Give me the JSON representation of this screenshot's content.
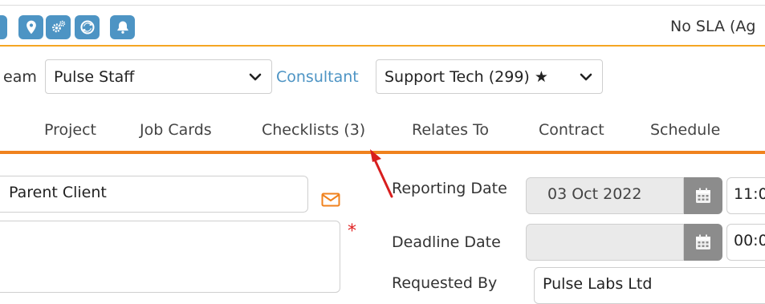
{
  "header": {
    "sla_text": "No SLA (Ag",
    "icons": [
      "map-pin-icon",
      "cogs-icon",
      "refresh-icon",
      "bell-icon"
    ],
    "accent_color": "#f5a623",
    "icon_color": "#4d94c4"
  },
  "assignment": {
    "team_label": "eam",
    "team_value": "Pulse Staff",
    "consultant_label": "Consultant",
    "consultant_value": "Support Tech (299) ★"
  },
  "tabs": [
    "Project",
    "Job Cards",
    "Checklists (3)",
    "Relates To",
    "Contract",
    "Schedule"
  ],
  "form": {
    "parent_client_value": "Parent Client",
    "reporting_date_label": "Reporting Date",
    "reporting_date_value": "03 Oct 2022",
    "reporting_time_value": "11:0",
    "deadline_date_label": "Deadline Date",
    "deadline_date_value": "",
    "deadline_time_value": "00:0",
    "requested_by_label": "Requested By",
    "requested_by_value": "Pulse Labs Ltd"
  }
}
